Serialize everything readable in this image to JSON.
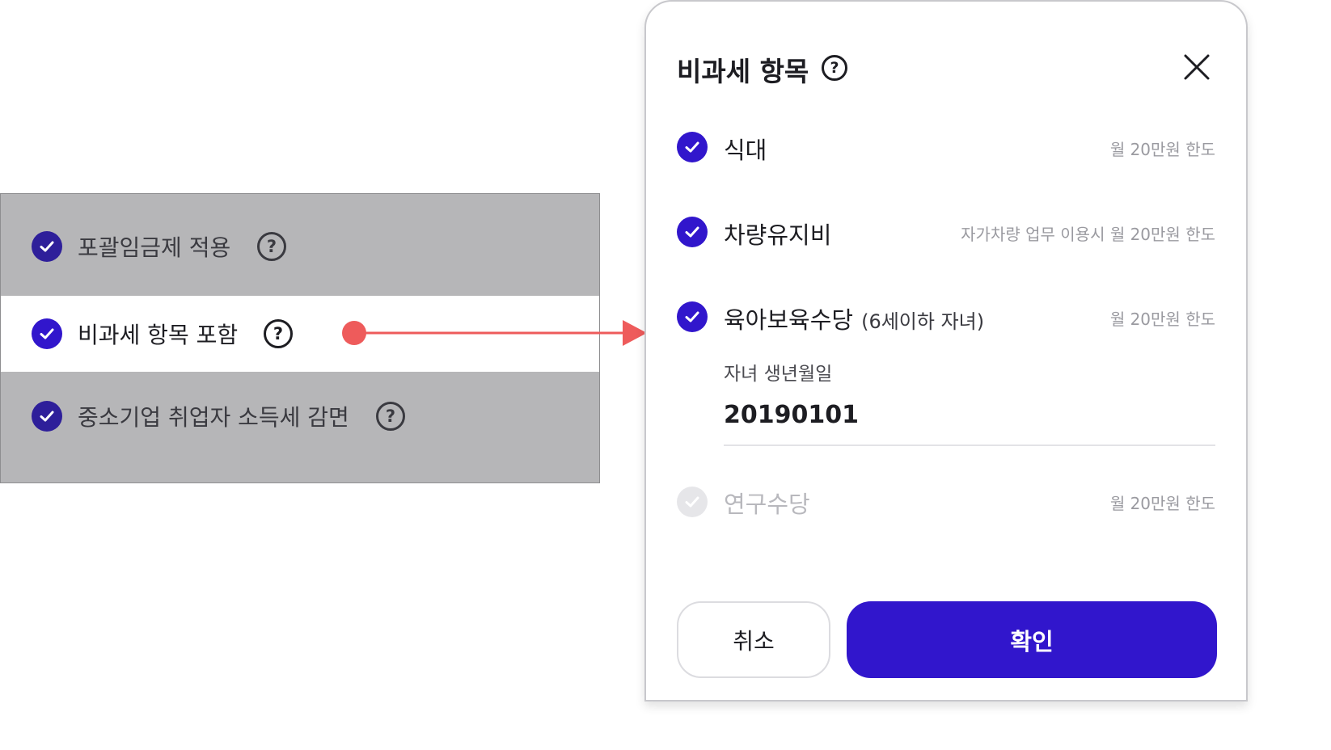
{
  "settings": {
    "items": [
      {
        "label": "포괄임금제 적용"
      },
      {
        "label": "비과세 항목 포함"
      },
      {
        "label": "중소기업 취업자 소득세 감면"
      }
    ],
    "help_glyph": "?"
  },
  "modal": {
    "title": "비과세 항목",
    "help_glyph": "?",
    "items": [
      {
        "label": "식대",
        "sub": "",
        "limit": "월 20만원 한도",
        "checked": true,
        "disabled": false
      },
      {
        "label": "차량유지비",
        "sub": "",
        "limit": "자가차량 업무 이용시 월 20만원 한도",
        "checked": true,
        "disabled": false
      },
      {
        "label": "육아보육수당",
        "sub": "(6세이하 자녀)",
        "limit": "월 20만원 한도",
        "checked": true,
        "disabled": false
      },
      {
        "label": "연구수당",
        "sub": "",
        "limit": "월 20만원 한도",
        "checked": false,
        "disabled": true
      }
    ],
    "birth": {
      "label": "자녀 생년월일",
      "value": "20190101"
    },
    "cancel_label": "취소",
    "confirm_label": "확인"
  },
  "colors": {
    "accent": "#3116cc",
    "overlay": "#b6b6b8",
    "connector": "#ee5b5b",
    "disabled": "#e6e6e9"
  },
  "icons": [
    "check-icon",
    "help-icon",
    "close-icon",
    "arrow-icon"
  ]
}
